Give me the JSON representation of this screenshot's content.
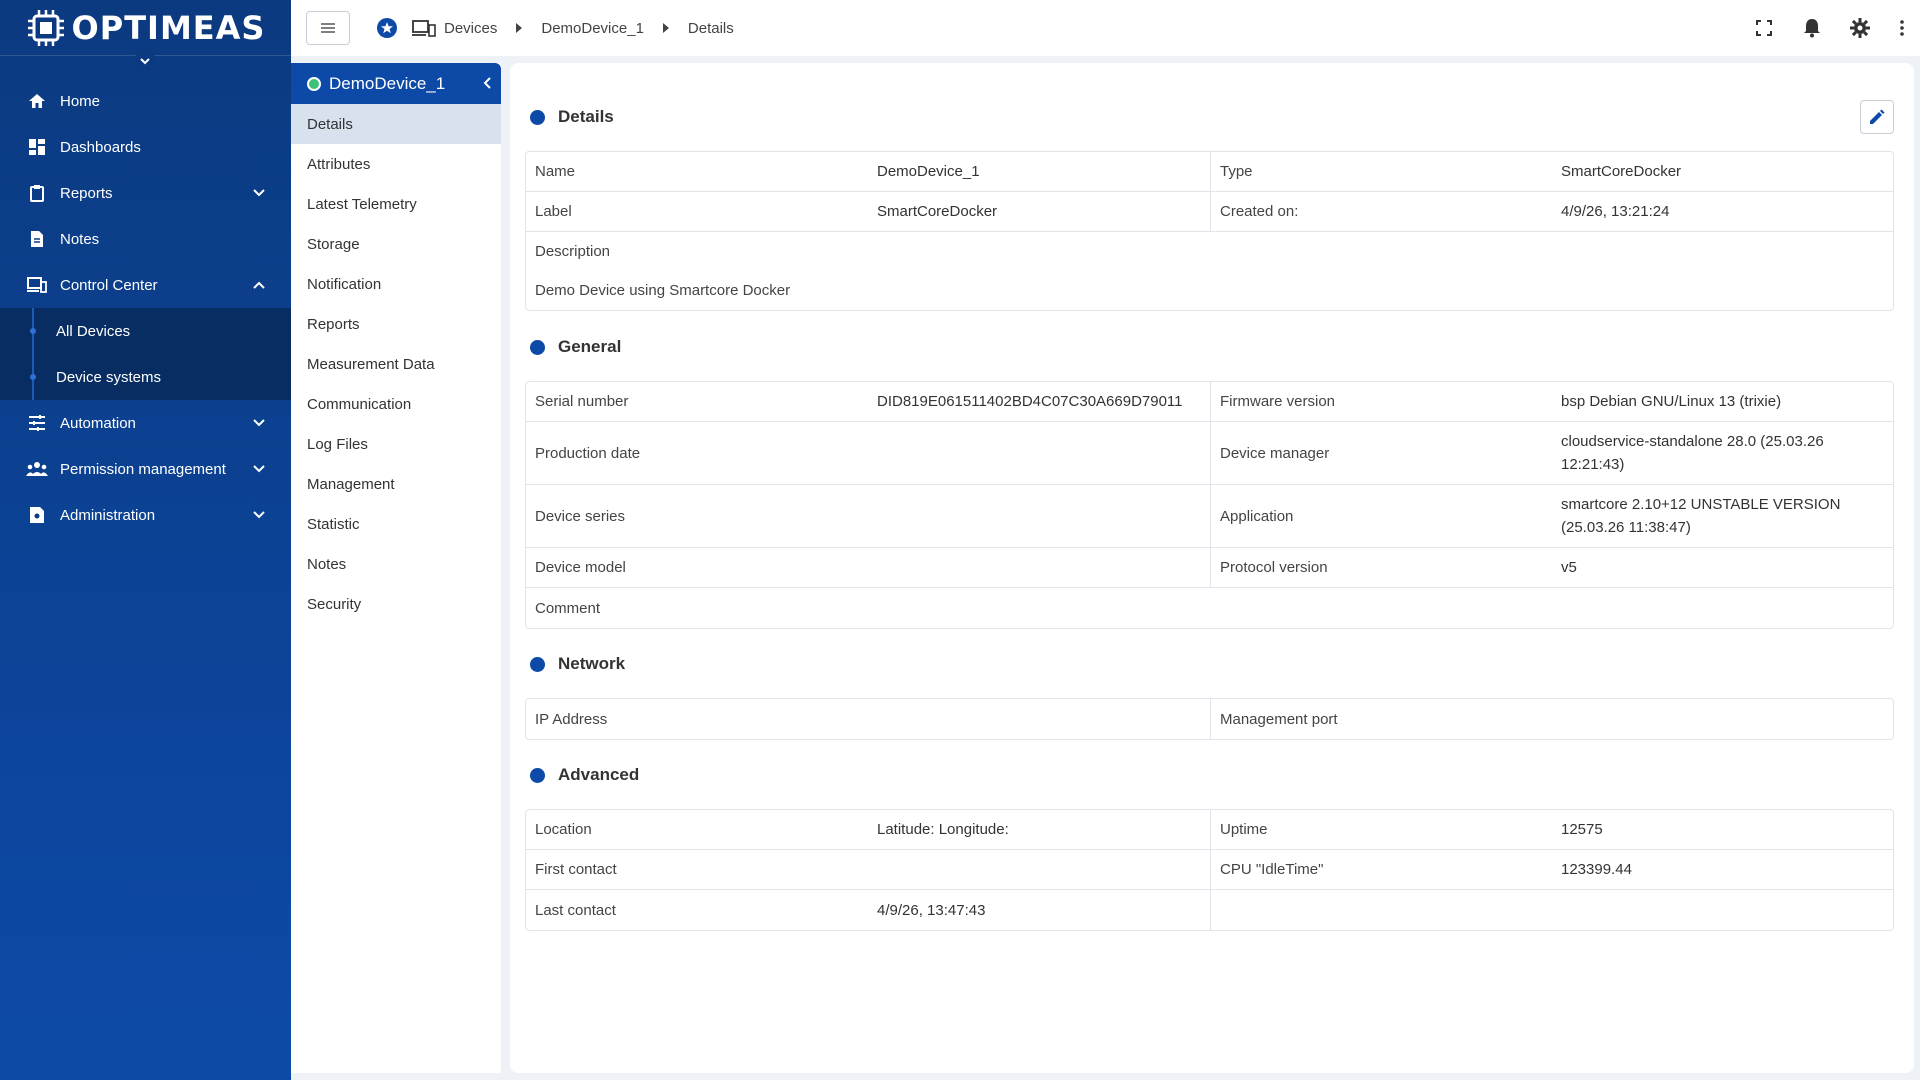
{
  "brand": {
    "name": "OPTIMEAS"
  },
  "nav": {
    "items": [
      {
        "label": "Home",
        "icon": "home-icon"
      },
      {
        "label": "Dashboards",
        "icon": "dashboard-icon"
      },
      {
        "label": "Reports",
        "icon": "clipboard-icon"
      },
      {
        "label": "Notes",
        "icon": "note-icon"
      },
      {
        "label": "Control Center",
        "icon": "devices-icon"
      },
      {
        "label": "All Devices"
      },
      {
        "label": "Device systems"
      },
      {
        "label": "Automation",
        "icon": "sliders-icon"
      },
      {
        "label": "Permission management",
        "icon": "people-icon"
      },
      {
        "label": "Administration",
        "icon": "admin-icon"
      }
    ]
  },
  "breadcrumb": {
    "devices": "Devices",
    "device": "DemoDevice_1",
    "page": "Details"
  },
  "device_panel": {
    "title": "DemoDevice_1",
    "items": [
      "Details",
      "Attributes",
      "Latest Telemetry",
      "Storage",
      "Notification",
      "Reports",
      "Measurement Data",
      "Communication",
      "Log Files",
      "Management",
      "Statistic",
      "Notes",
      "Security"
    ]
  },
  "details": {
    "title": "Details",
    "name_label": "Name",
    "name_value": "DemoDevice_1",
    "type_label": "Type",
    "type_value": "SmartCoreDocker",
    "label_label": "Label",
    "label_value": "SmartCoreDocker",
    "created_label": "Created on:",
    "created_value": "4/9/26, 13:21:24",
    "description_label": "Description",
    "description_value": "Demo Device using Smartcore Docker"
  },
  "general": {
    "title": "General",
    "serial_label": "Serial number",
    "serial_value": "DID819E061511402BD4C07C30A669D79011",
    "firmware_label": "Firmware version",
    "firmware_value": "bsp Debian GNU/Linux 13 (trixie)",
    "production_label": "Production date",
    "manager_label": "Device manager",
    "manager_value_1": "cloudservice-standalone 28.0 (25.03.26",
    "manager_value_2": "12:21:43)",
    "series_label": "Device series",
    "application_label": "Application",
    "application_value_1": "smartcore 2.10+12 UNSTABLE VERSION",
    "application_value_2": "(25.03.26 11:38:47)",
    "model_label": "Device model",
    "protocol_label": "Protocol version",
    "protocol_value": "v5",
    "comment_label": "Comment"
  },
  "network": {
    "title": "Network",
    "ip_label": "IP Address",
    "port_label": "Management port"
  },
  "advanced": {
    "title": "Advanced",
    "location_label": "Location",
    "location_value": "Latitude: Longitude:",
    "uptime_label": "Uptime",
    "uptime_value": "12575",
    "first_contact_label": "First contact",
    "cpu_label": "CPU \"IdleTime\"",
    "cpu_value": "123399.44",
    "last_contact_label": "Last contact",
    "last_contact_value": "4/9/26, 13:47:43"
  },
  "colors": {
    "nav_bg": "#0d4aa8",
    "accent": "#0d4aa8",
    "status_online": "#3cc07a"
  }
}
